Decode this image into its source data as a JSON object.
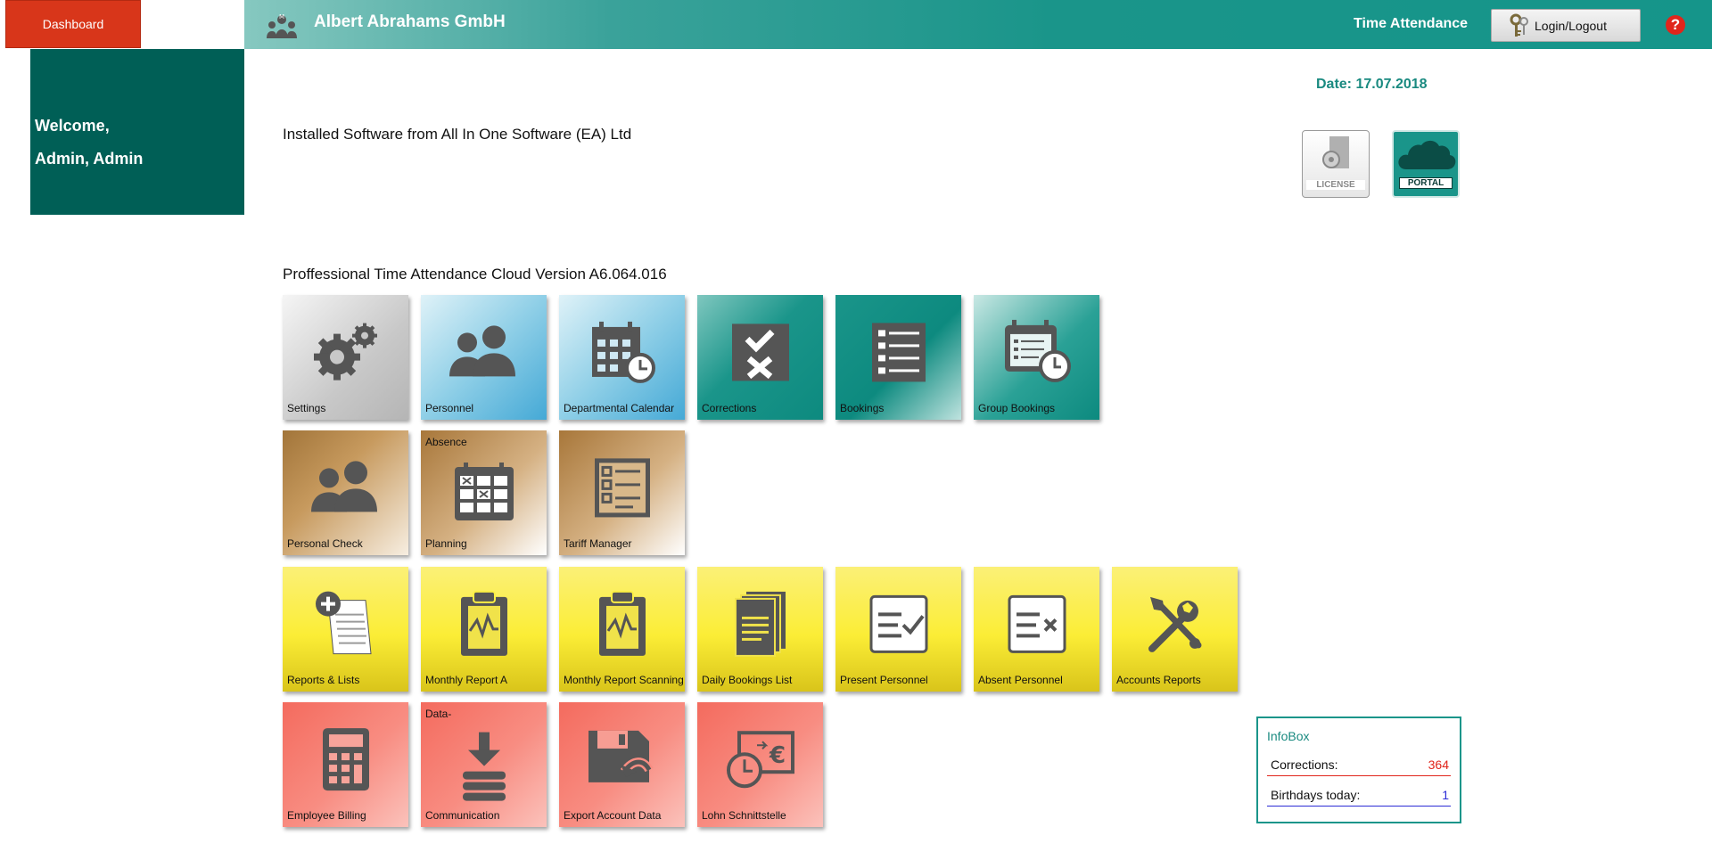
{
  "topbar": {
    "dashboard_label": "Dashboard",
    "company_name": "Albert Abrahams GmbH",
    "module_label": "Time Attendance",
    "login_label": "Login/Logout",
    "help_symbol": "?"
  },
  "welcome": {
    "line1": "Welcome,",
    "line2": "Admin, Admin"
  },
  "date": "Date:  17.07.2018",
  "installed_text": "Installed Software from All In One Software (EA) Ltd",
  "badges": {
    "license": "LICENSE",
    "portal": "PORTAL"
  },
  "version_text": "Proffessional Time Attendance Cloud Version  A6.064.016",
  "tiles": [
    {
      "label": "Settings",
      "icon": "gears-icon"
    },
    {
      "label": "Personnel",
      "icon": "people-icon"
    },
    {
      "label": "Departmental Calendar",
      "icon": "calendar-clock-icon"
    },
    {
      "label": "Corrections",
      "icon": "check-cross-icon"
    },
    {
      "label": "Bookings",
      "icon": "checklist-icon"
    },
    {
      "label": "Group Bookings",
      "icon": "schedule-clock-icon"
    },
    {
      "label": "Personal Check",
      "icon": "people-icon"
    },
    {
      "label": "Planning",
      "top_label": "Absence",
      "icon": "grid-calendar-icon"
    },
    {
      "label": "Tariff Manager",
      "icon": "checklist-icon"
    },
    {
      "label": "Reports & Lists",
      "icon": "add-document-icon"
    },
    {
      "label": "Monthly Report A",
      "icon": "clipboard-chart-icon"
    },
    {
      "label": "Monthly Report Scanning",
      "icon": "clipboard-chart-icon"
    },
    {
      "label": "Daily Bookings List",
      "icon": "documents-icon"
    },
    {
      "label": "Present Personnel",
      "icon": "list-check-icon"
    },
    {
      "label": "Absent Personnel",
      "icon": "list-cross-icon"
    },
    {
      "label": "Accounts Reports",
      "icon": "tools-icon"
    },
    {
      "label": "Employee Billing",
      "icon": "calculator-icon"
    },
    {
      "label": "Communication",
      "top_label": "Data-",
      "icon": "download-stack-icon"
    },
    {
      "label": "Export Account Data",
      "icon": "floppy-export-icon"
    },
    {
      "label": "Lohn Schnittstelle",
      "icon": "clock-euro-icon"
    }
  ],
  "infobox": {
    "title": "InfoBox",
    "corrections_label": "Corrections:",
    "corrections_value": "364",
    "birthdays_label": "Birthdays today:",
    "birthdays_value": "1"
  },
  "colors": {
    "teal": "#1a958a",
    "dashboard_red": "#d8361a",
    "welcome_green": "#005f56"
  }
}
